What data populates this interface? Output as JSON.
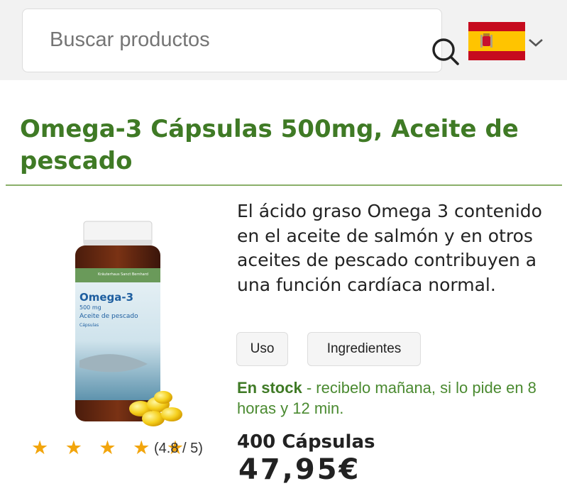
{
  "search": {
    "placeholder": "Buscar productos",
    "icon": "search-icon"
  },
  "language": {
    "flag": "spain-flag",
    "selector_icon": "chevron-down-icon"
  },
  "product": {
    "title": "Omega-3 Cápsulas 500mg, Aceite de pescado",
    "description": "El ácido graso Omega 3 contenido en el aceite de salmón y en otros aceites de pescado contribuyen a una función cardíaca normal.",
    "tabs": [
      "Uso",
      "Ingredientes"
    ],
    "stock_label": "En stock",
    "stock_detail": " - recibelo mañana, si lo pide en 8 horas y 12 min.",
    "stars": "★ ★ ★ ★ ★",
    "rating_value": 4.8,
    "rating_text": "(4.8 / 5)",
    "quantity": "400 Cápsulas",
    "price_partial": "47,95€",
    "image_label": {
      "brand": "Kräuterhaus Sanct Bernhard",
      "name": "Omega-3",
      "dose": "500 mg",
      "subtitle": "Aceite de pescado",
      "type": "Cápsulas"
    }
  },
  "colors": {
    "accent_green": "#3f7a25",
    "star": "#f2a50c"
  }
}
